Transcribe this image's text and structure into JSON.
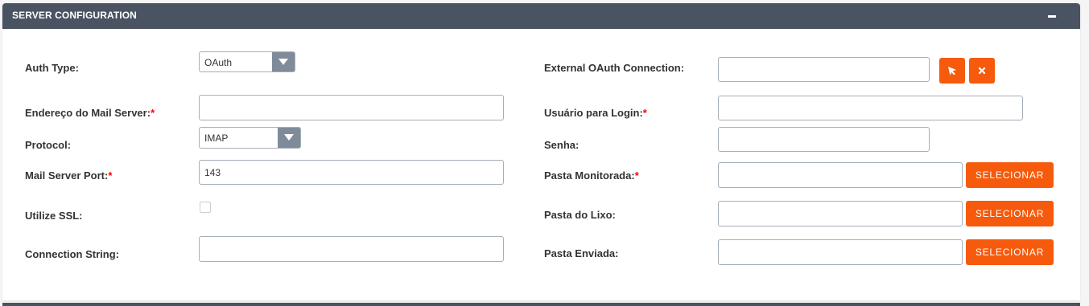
{
  "panel": {
    "title": "SERVER CONFIGURATION",
    "collapse_icon": "minus-icon"
  },
  "required_marker": "*",
  "left": {
    "auth_type": {
      "label": "Auth Type:",
      "value": "OAuth"
    },
    "mail_server_address": {
      "label": "Endereço do Mail Server:",
      "value": ""
    },
    "protocol": {
      "label": "Protocol:",
      "value": "IMAP"
    },
    "mail_server_port": {
      "label": "Mail Server Port:",
      "value": "143"
    },
    "use_ssl": {
      "label": "Utilize SSL:",
      "checked": false
    },
    "connection_string": {
      "label": "Connection String:",
      "value": ""
    }
  },
  "right": {
    "external_oauth": {
      "label": "External OAuth Connection:",
      "value": "",
      "select_icon": "cursor-arrow-icon",
      "clear_icon": "close-icon"
    },
    "login_user": {
      "label": "Usuário para Login:",
      "value": ""
    },
    "password": {
      "label": "Senha:",
      "value": ""
    },
    "monitored_folder": {
      "label": "Pasta Monitorada:",
      "value": "",
      "button": "SELECIONAR"
    },
    "trash_folder": {
      "label": "Pasta do Lixo:",
      "value": "",
      "button": "SELECIONAR"
    },
    "sent_folder": {
      "label": "Pasta Enviada:",
      "value": "",
      "button": "SELECIONAR"
    }
  },
  "colors": {
    "header": "#4a5362",
    "accent": "#f65a0c",
    "required": "#ff0000"
  }
}
